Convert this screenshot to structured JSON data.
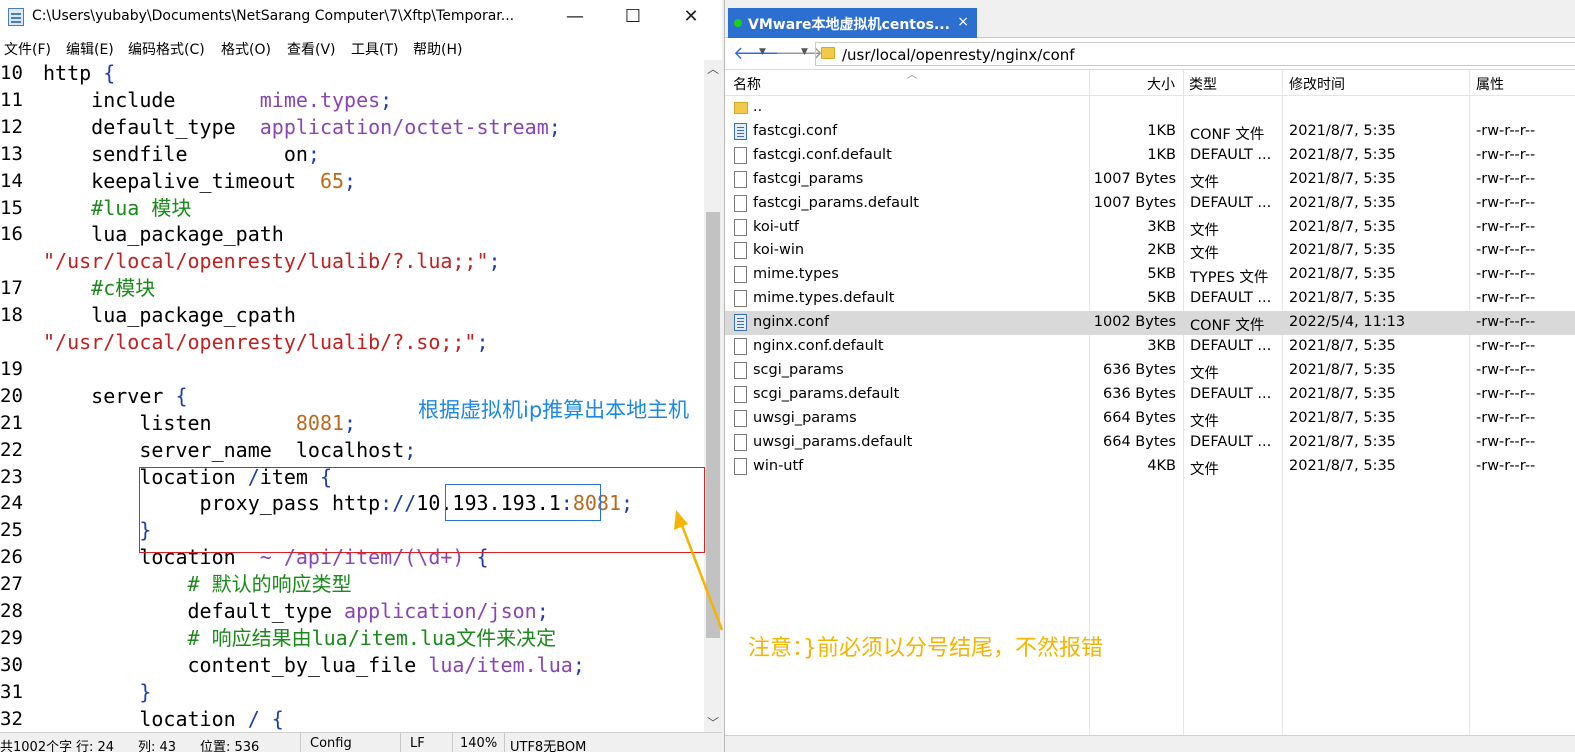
{
  "editor": {
    "title": "C:\\Users\\yubaby\\Documents\\NetSarang Computer\\7\\Xftp\\Temporar...",
    "window_buttons": {
      "minimize": "—",
      "maximize": "☐",
      "close": "✕"
    },
    "menu": [
      "文件(F)",
      "编辑(E)",
      "编码格式(C)",
      "格式(O)",
      "查看(V)",
      "工具(T)",
      "帮助(H)"
    ],
    "lines": [
      {
        "no": "10",
        "parts": [
          [
            "kw",
            "http "
          ],
          [
            "blue",
            "{"
          ]
        ]
      },
      {
        "no": "11",
        "parts": [
          [
            "kw",
            "    include       "
          ],
          [
            "val",
            "mime.types"
          ],
          [
            "blue",
            ";"
          ]
        ]
      },
      {
        "no": "12",
        "parts": [
          [
            "kw",
            "    default_type  "
          ],
          [
            "val",
            "application/octet-stream"
          ],
          [
            "blue",
            ";"
          ]
        ]
      },
      {
        "no": "13",
        "parts": [
          [
            "kw",
            "    sendfile        "
          ],
          [
            "kw",
            "on"
          ],
          [
            "blue",
            ";"
          ]
        ]
      },
      {
        "no": "14",
        "parts": [
          [
            "kw",
            "    keepalive_timeout  "
          ],
          [
            "num",
            "65"
          ],
          [
            "blue",
            ";"
          ]
        ]
      },
      {
        "no": "15",
        "parts": [
          [
            "cmt",
            "    #lua 模块"
          ]
        ]
      },
      {
        "no": "16",
        "parts": [
          [
            "kw",
            "    lua_package_path"
          ]
        ]
      },
      {
        "no": "",
        "parts": [
          [
            "str",
            "\"/usr/local/openresty/lualib/?.lua;;\""
          ],
          [
            "blue",
            ";"
          ]
        ]
      },
      {
        "no": "17",
        "parts": [
          [
            "cmt",
            "    #c模块"
          ]
        ]
      },
      {
        "no": "18",
        "parts": [
          [
            "kw",
            "    lua_package_cpath"
          ]
        ]
      },
      {
        "no": "",
        "parts": [
          [
            "str",
            "\"/usr/local/openresty/lualib/?.so;;\""
          ],
          [
            "blue",
            ";"
          ]
        ]
      },
      {
        "no": "19",
        "parts": []
      },
      {
        "no": "20",
        "parts": [
          [
            "kw",
            "    server "
          ],
          [
            "blue",
            "{"
          ]
        ]
      },
      {
        "no": "21",
        "parts": [
          [
            "kw",
            "        listen       "
          ],
          [
            "num",
            "8081"
          ],
          [
            "blue",
            ";"
          ]
        ]
      },
      {
        "no": "22",
        "parts": [
          [
            "kw",
            "        server_name  localhost"
          ],
          [
            "blue",
            ";"
          ]
        ]
      },
      {
        "no": "23",
        "parts": [
          [
            "kw",
            "        location "
          ],
          [
            "blue",
            "/"
          ],
          [
            "kw",
            "item "
          ],
          [
            "blue",
            "{"
          ]
        ]
      },
      {
        "no": "24",
        "parts": [
          [
            "kw",
            "             proxy_pass http"
          ],
          [
            "blue",
            "://"
          ],
          [
            "kw",
            "10.193.193.1"
          ],
          [
            "blue",
            ":"
          ],
          [
            "num",
            "8081"
          ],
          [
            "blue",
            ";"
          ]
        ]
      },
      {
        "no": "25",
        "parts": [
          [
            "blue",
            "        }"
          ]
        ]
      },
      {
        "no": "26",
        "parts": [
          [
            "kw",
            "        location  "
          ],
          [
            "val",
            "~ /api/item/(\\d+)"
          ],
          [
            "blue",
            " {"
          ]
        ]
      },
      {
        "no": "27",
        "parts": [
          [
            "cmt",
            "            # 默认的响应类型"
          ]
        ]
      },
      {
        "no": "28",
        "parts": [
          [
            "kw",
            "            default_type "
          ],
          [
            "val",
            "application/json"
          ],
          [
            "blue",
            ";"
          ]
        ]
      },
      {
        "no": "29",
        "parts": [
          [
            "cmt",
            "            # 响应结果由lua/item.lua文件来决定"
          ]
        ]
      },
      {
        "no": "30",
        "parts": [
          [
            "kw",
            "            content_by_lua_file "
          ],
          [
            "val",
            "lua/item.lua"
          ],
          [
            "blue",
            ";"
          ]
        ]
      },
      {
        "no": "31",
        "parts": [
          [
            "blue",
            "        }"
          ]
        ]
      },
      {
        "no": "32",
        "parts": [
          [
            "kw",
            "        location "
          ],
          [
            "blue",
            "/ {"
          ]
        ]
      }
    ],
    "status": {
      "summary": "共1002个字",
      "line": "行: 24",
      "col": "列: 43",
      "pos": "位置: 536",
      "type": "Config",
      "eol": "LF",
      "zoom": "140%",
      "encoding": "UTF8无BOM"
    }
  },
  "annotations": {
    "blue_note": "根据虚拟机ip推算出本地主机",
    "orange_note": "注意：}前必须以分号结尾，不然报错"
  },
  "xftp": {
    "tab_label": "VMware本地虚拟机centos...",
    "tab_close": "×",
    "path": "/usr/local/openresty/nginx/conf",
    "columns": {
      "name": "名称",
      "size": "大小",
      "type": "类型",
      "modified": "修改时间",
      "attrs": "属性"
    },
    "files": [
      {
        "icon": "folder",
        "name": "..",
        "size": "",
        "type": "",
        "modified": "",
        "attrs": ""
      },
      {
        "icon": "conf",
        "name": "fastcgi.conf",
        "size": "1KB",
        "type": "CONF 文件",
        "modified": "2021/8/7, 5:35",
        "attrs": "-rw-r--r--"
      },
      {
        "icon": "file",
        "name": "fastcgi.conf.default",
        "size": "1KB",
        "type": "DEFAULT ...",
        "modified": "2021/8/7, 5:35",
        "attrs": "-rw-r--r--"
      },
      {
        "icon": "file",
        "name": "fastcgi_params",
        "size": "1007 Bytes",
        "type": "文件",
        "modified": "2021/8/7, 5:35",
        "attrs": "-rw-r--r--"
      },
      {
        "icon": "file",
        "name": "fastcgi_params.default",
        "size": "1007 Bytes",
        "type": "DEFAULT ...",
        "modified": "2021/8/7, 5:35",
        "attrs": "-rw-r--r--"
      },
      {
        "icon": "file",
        "name": "koi-utf",
        "size": "3KB",
        "type": "文件",
        "modified": "2021/8/7, 5:35",
        "attrs": "-rw-r--r--"
      },
      {
        "icon": "file",
        "name": "koi-win",
        "size": "2KB",
        "type": "文件",
        "modified": "2021/8/7, 5:35",
        "attrs": "-rw-r--r--"
      },
      {
        "icon": "file",
        "name": "mime.types",
        "size": "5KB",
        "type": "TYPES 文件",
        "modified": "2021/8/7, 5:35",
        "attrs": "-rw-r--r--"
      },
      {
        "icon": "file",
        "name": "mime.types.default",
        "size": "5KB",
        "type": "DEFAULT ...",
        "modified": "2021/8/7, 5:35",
        "attrs": "-rw-r--r--"
      },
      {
        "icon": "conf",
        "name": "nginx.conf",
        "size": "1002 Bytes",
        "type": "CONF 文件",
        "modified": "2022/5/4, 11:13",
        "attrs": "-rw-r--r--",
        "selected": true
      },
      {
        "icon": "file",
        "name": "nginx.conf.default",
        "size": "3KB",
        "type": "DEFAULT ...",
        "modified": "2021/8/7, 5:35",
        "attrs": "-rw-r--r--"
      },
      {
        "icon": "file",
        "name": "scgi_params",
        "size": "636 Bytes",
        "type": "文件",
        "modified": "2021/8/7, 5:35",
        "attrs": "-rw-r--r--"
      },
      {
        "icon": "file",
        "name": "scgi_params.default",
        "size": "636 Bytes",
        "type": "DEFAULT ...",
        "modified": "2021/8/7, 5:35",
        "attrs": "-rw-r--r--"
      },
      {
        "icon": "file",
        "name": "uwsgi_params",
        "size": "664 Bytes",
        "type": "文件",
        "modified": "2021/8/7, 5:35",
        "attrs": "-rw-r--r--"
      },
      {
        "icon": "file",
        "name": "uwsgi_params.default",
        "size": "664 Bytes",
        "type": "DEFAULT ...",
        "modified": "2021/8/7, 5:35",
        "attrs": "-rw-r--r--"
      },
      {
        "icon": "file",
        "name": "win-utf",
        "size": "4KB",
        "type": "文件",
        "modified": "2021/8/7, 5:35",
        "attrs": "-rw-r--r--"
      }
    ]
  },
  "colors": {
    "accent": "#2d6fd1",
    "annotation_red": "#e02020",
    "annotation_blue": "#1e88e5",
    "annotation_orange": "#f5b400"
  }
}
